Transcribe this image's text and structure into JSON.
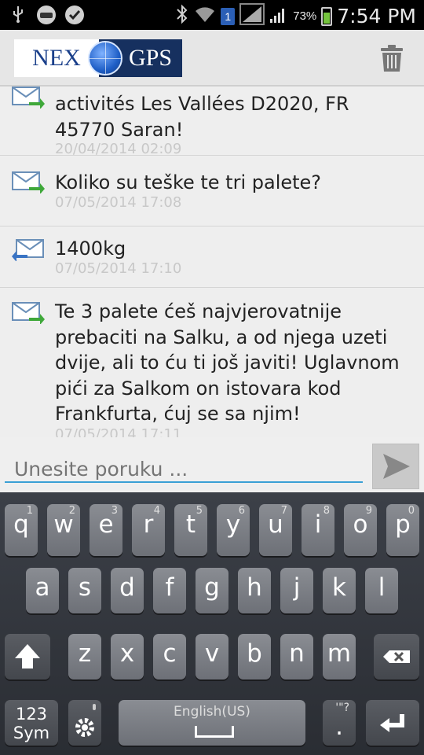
{
  "status_bar": {
    "time": "7:54 PM",
    "battery_percent": "73%",
    "sim_number": "1",
    "icons": [
      "usb-icon",
      "app-notification-icon",
      "check-icon",
      "bluetooth-icon",
      "wifi-icon",
      "sim-icon",
      "signal-icon",
      "signal-icon",
      "battery-icon"
    ]
  },
  "app_bar": {
    "logo_left": "NEX",
    "logo_right": "GPS",
    "delete_icon": "trash-icon"
  },
  "messages": [
    {
      "direction": "outgoing",
      "text": "activités Les Vallées D2020, FR 45770 Saran!",
      "time": "20/04/2014 02:09"
    },
    {
      "direction": "outgoing",
      "text": "Koliko su teške te tri palete?",
      "time": "07/05/2014 17:08"
    },
    {
      "direction": "incoming",
      "text": "1400kg",
      "time": "07/05/2014 17:10"
    },
    {
      "direction": "outgoing",
      "text": "Te 3 palete ćeš najvjerovatnije prebaciti na Salku, a od njega uzeti dvije, ali to ću ti još javiti! Uglavnom pići za Salkom on istovara kod Frankfurta, ćuj se sa njim!",
      "time": "07/05/2014 17:11"
    }
  ],
  "compose": {
    "placeholder": "Unesite poruku ...",
    "send_icon": "send-icon"
  },
  "keyboard": {
    "row1": [
      {
        "ch": "q",
        "num": "1"
      },
      {
        "ch": "w",
        "num": "2"
      },
      {
        "ch": "e",
        "num": "3"
      },
      {
        "ch": "r",
        "num": "4"
      },
      {
        "ch": "t",
        "num": "5"
      },
      {
        "ch": "y",
        "num": "6"
      },
      {
        "ch": "u",
        "num": "7"
      },
      {
        "ch": "i",
        "num": "8"
      },
      {
        "ch": "o",
        "num": "9"
      },
      {
        "ch": "p",
        "num": "0"
      }
    ],
    "row2": [
      "a",
      "s",
      "d",
      "f",
      "g",
      "h",
      "j",
      "k",
      "l"
    ],
    "row3": [
      "z",
      "x",
      "c",
      "v",
      "b",
      "n",
      "m"
    ],
    "sym_label_top": "123",
    "sym_label_bottom": "Sym",
    "space_label": "English(US)",
    "period_label": ".",
    "period_hint": "'\"?"
  }
}
